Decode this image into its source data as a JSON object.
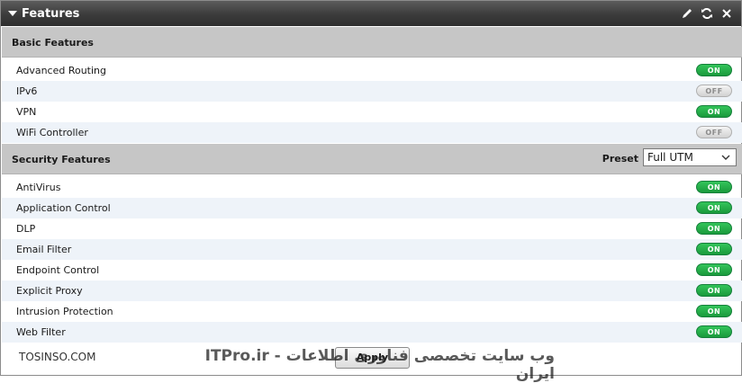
{
  "panel": {
    "title": "Features"
  },
  "basic": {
    "title": "Basic Features",
    "items": [
      {
        "label": "Advanced Routing",
        "state": "ON"
      },
      {
        "label": "IPv6",
        "state": "OFF"
      },
      {
        "label": "VPN",
        "state": "ON"
      },
      {
        "label": "WiFi Controller",
        "state": "OFF"
      }
    ]
  },
  "security": {
    "title": "Security Features",
    "preset_label": "Preset",
    "preset_value": "Full UTM",
    "items": [
      {
        "label": "AntiVirus",
        "state": "ON"
      },
      {
        "label": "Application Control",
        "state": "ON"
      },
      {
        "label": "DLP",
        "state": "ON"
      },
      {
        "label": "Email Filter",
        "state": "ON"
      },
      {
        "label": "Endpoint Control",
        "state": "ON"
      },
      {
        "label": "Explicit Proxy",
        "state": "ON"
      },
      {
        "label": "Intrusion Protection",
        "state": "ON"
      },
      {
        "label": "Web Filter",
        "state": "ON"
      }
    ]
  },
  "footer": {
    "apply_label": "Apply",
    "watermark_left": "TOSINSO.COM",
    "watermark_right": "ITPro.ir - وب سایت تخصصی فناوری اطلاعات ایران"
  },
  "colors": {
    "toggle_on": "#22aa46",
    "toggle_off": "#dcdcdc",
    "titlebar": "#3b3b3b",
    "section_header": "#c6c6c6",
    "row_alt": "#eef3f9"
  },
  "icons": [
    "collapse-arrow-icon",
    "edit-icon",
    "refresh-icon",
    "close-icon",
    "chevron-down-icon"
  ]
}
